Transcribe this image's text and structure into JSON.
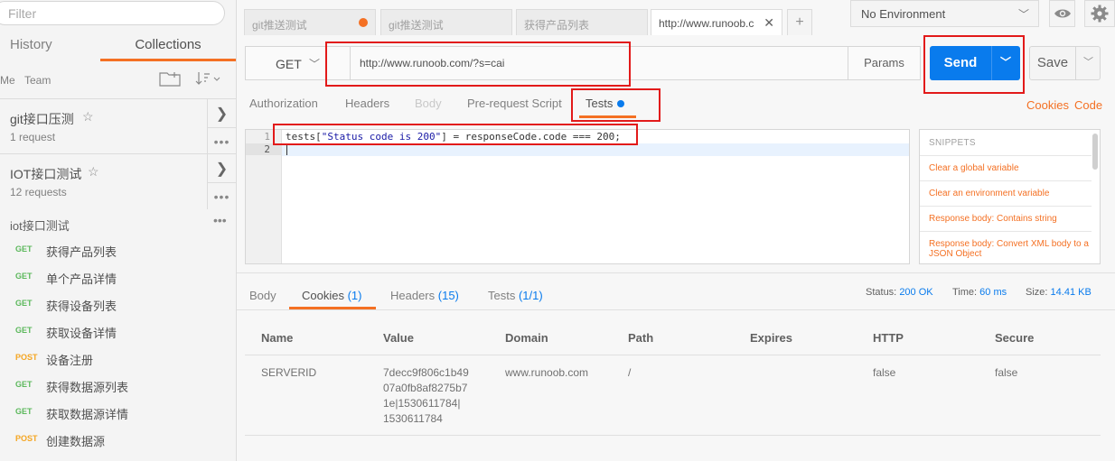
{
  "sidebar": {
    "filter_placeholder": "Filter",
    "tabs": {
      "history": "History",
      "collections": "Collections"
    },
    "scope": {
      "me": "Me",
      "team": "Team"
    },
    "collections": [
      {
        "name": "git接口压测",
        "count": "1 request"
      },
      {
        "name": "IOT接口测试",
        "count": "12 requests"
      }
    ],
    "folder": "iot接口测试",
    "requests": [
      {
        "method": "GET",
        "name": "获得产品列表"
      },
      {
        "method": "GET",
        "name": "单个产品详情"
      },
      {
        "method": "GET",
        "name": "获得设备列表"
      },
      {
        "method": "GET",
        "name": "获取设备详情"
      },
      {
        "method": "POST",
        "name": "设备注册"
      },
      {
        "method": "GET",
        "name": "获得数据源列表"
      },
      {
        "method": "GET",
        "name": "获取数据源详情"
      },
      {
        "method": "POST",
        "name": "创建数据源"
      }
    ]
  },
  "tabs": [
    {
      "label": "git推送测试",
      "unsaved": true
    },
    {
      "label": "git推送测试"
    },
    {
      "label": "获得产品列表"
    },
    {
      "label": "http://www.runoob.c",
      "active": true
    }
  ],
  "environment": {
    "selected": "No Environment"
  },
  "request": {
    "method": "GET",
    "url": "http://www.runoob.com/?s=cai",
    "params_label": "Params",
    "send_label": "Send",
    "save_label": "Save",
    "subtabs": [
      "Authorization",
      "Headers",
      "Body",
      "Pre-request Script",
      "Tests"
    ],
    "links": {
      "cookies": "Cookies",
      "code": "Code"
    }
  },
  "editor": {
    "line_numbers": [
      "1",
      "2"
    ],
    "code": {
      "prefix": "tests[",
      "string": "\"Status code is 200\"",
      "suffix": "] = responseCode.code === 200;"
    }
  },
  "snippets": {
    "header": "SNIPPETS",
    "items": [
      "Clear a global variable",
      "Clear an environment variable",
      "Response body: Contains string",
      "Response body: Convert XML body to a JSON Object"
    ]
  },
  "response": {
    "tabs": [
      {
        "label": "Body",
        "count": ""
      },
      {
        "label": "Cookies",
        "count": "(1)"
      },
      {
        "label": "Headers",
        "count": "(15)"
      },
      {
        "label": "Tests",
        "count": "(1/1)"
      }
    ],
    "status": {
      "label": "Status:",
      "value": "200 OK"
    },
    "time": {
      "label": "Time:",
      "value": "60 ms"
    },
    "size": {
      "label": "Size:",
      "value": "14.41 KB"
    },
    "cookie_columns": [
      "Name",
      "Value",
      "Domain",
      "Path",
      "Expires",
      "HTTP",
      "Secure"
    ],
    "cookies": [
      {
        "name": "SERVERID",
        "value_lines": [
          "7decc9f806c1b49",
          "07a0fb8af8275b7",
          "1e|1530611784|",
          "1530611784"
        ],
        "domain": "www.runoob.com",
        "path": "/",
        "expires": "",
        "http": "false",
        "secure": "false"
      }
    ]
  },
  "colors": {
    "accent": "#f47023",
    "send": "#097bed",
    "get": "#5cb85c",
    "post": "#f5a623",
    "annotation": "#e21a1a"
  }
}
